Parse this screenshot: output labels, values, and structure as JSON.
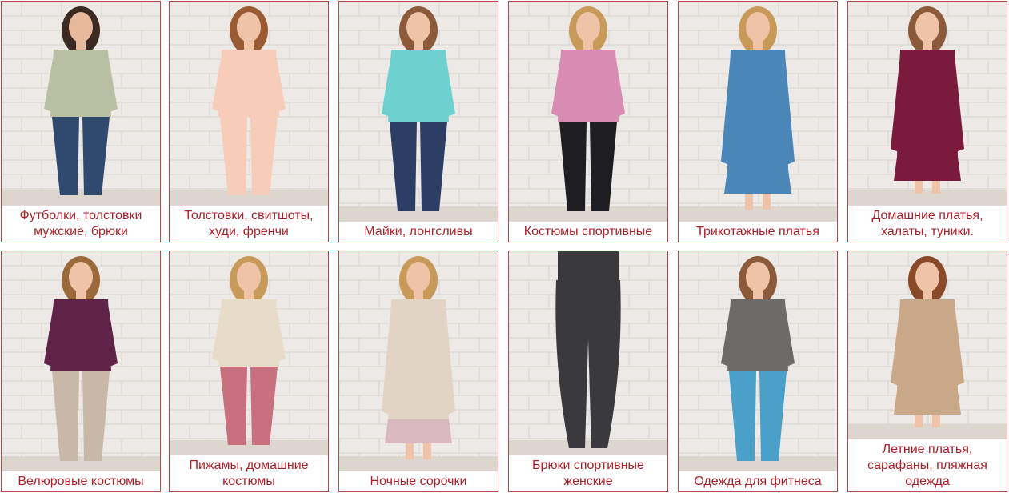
{
  "colors": {
    "accent": "#b01e2a",
    "border": "#b94a4a",
    "wall": "#ece9e6"
  },
  "categories": [
    {
      "label": "Футболки, толстовки мужские, брюки",
      "figure": "man-sweatshirt",
      "top": "#b9bfa3",
      "bottom": "#2f4a6e",
      "skin": "#e6b89c",
      "hair": "#3a2a22"
    },
    {
      "label": "Толстовки, свитшоты, худи, френчи",
      "figure": "woman-top",
      "top": "#f7cdb9",
      "bottom": "#f7cdb9",
      "skin": "#efc3a8",
      "hair": "#9a5a32"
    },
    {
      "label": "Майки, лонгсливы",
      "figure": "woman-tshirt",
      "top": "#6fd1cf",
      "bottom": "#2c3e63",
      "skin": "#efc3a8",
      "hair": "#8a5a3a"
    },
    {
      "label": "Костюмы спортивные",
      "figure": "woman-tracksuit",
      "top": "#d98cb2",
      "bottom": "#1e1e22",
      "skin": "#efc3a8",
      "hair": "#c89a5a"
    },
    {
      "label": "Трикотажные платья",
      "figure": "woman-dress",
      "top": "#4a86b8",
      "bottom": "#4a86b8",
      "skin": "#efc3a8",
      "hair": "#c89a5a"
    },
    {
      "label": "Домашние платья, халаты, туники.",
      "figure": "woman-robe",
      "top": "#7a1b3d",
      "bottom": "#7a1b3d",
      "skin": "#efc3a8",
      "hair": "#8a5a3a"
    },
    {
      "label": "Велюровые костюмы",
      "figure": "woman-velour",
      "top": "#5e2346",
      "bottom": "#c8b8a8",
      "skin": "#efc3a8",
      "hair": "#9a6a3a"
    },
    {
      "label": "Пижамы, домашние костюмы",
      "figure": "woman-pajama",
      "top": "#e6dcc8",
      "bottom": "#c8707e",
      "skin": "#efc3a8",
      "hair": "#c89a5a"
    },
    {
      "label": "Ночные сорочки",
      "figure": "woman-nightgown",
      "top": "#e2d4c4",
      "bottom": "#d9b8c0",
      "skin": "#efc3a8",
      "hair": "#c89a5a"
    },
    {
      "label": "Брюки спортивные женские",
      "figure": "leggings",
      "top": "#3a3a3e",
      "bottom": "#3a3a3e",
      "skin": "#efc3a8",
      "hair": "#3a3a3e"
    },
    {
      "label": "Одежда для фитнеса",
      "figure": "woman-fitness",
      "top": "#6e6a6a",
      "bottom": "#4aa0c8",
      "skin": "#efc3a8",
      "hair": "#8a5a3a"
    },
    {
      "label": "Летние платья, сарафаны, пляжная одежда",
      "figure": "woman-sundress",
      "top": "#c9a88a",
      "bottom": "#c9a88a",
      "skin": "#efc3a8",
      "hair": "#8a4a2a"
    }
  ]
}
